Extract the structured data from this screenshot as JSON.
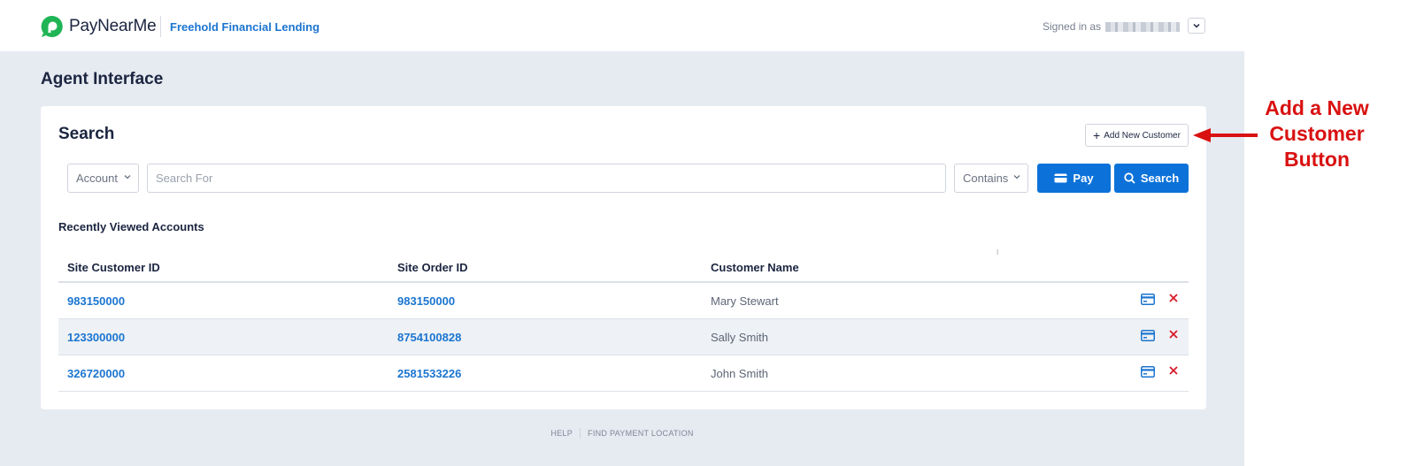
{
  "header": {
    "logo_text": "PayNearMe",
    "company": "Freehold Financial Lending",
    "signed_in_label": "Signed in as"
  },
  "page": {
    "title": "Agent Interface"
  },
  "search": {
    "title": "Search",
    "add_customer_label": "Add New Customer",
    "field_select": "Account",
    "input_placeholder": "Search For",
    "match_select": "Contains",
    "pay_label": "Pay",
    "search_label": "Search"
  },
  "recent": {
    "title": "Recently Viewed Accounts",
    "columns": [
      "Site Customer ID",
      "Site Order ID",
      "Customer Name"
    ],
    "rows": [
      {
        "customer_id": "983150000",
        "order_id": "983150000",
        "name": "Mary Stewart"
      },
      {
        "customer_id": "123300000",
        "order_id": "8754100828",
        "name": "Sally Smith"
      },
      {
        "customer_id": "326720000",
        "order_id": "2581533226",
        "name": "John Smith"
      }
    ]
  },
  "footer": {
    "links": [
      "HELP",
      "FIND PAYMENT LOCATION"
    ]
  },
  "annotation": {
    "lines": [
      "Add a New",
      "Customer",
      "Button"
    ]
  },
  "colors": {
    "brand_green": "#1fb455",
    "primary_blue": "#0c72d9",
    "link_blue": "#1b75d0",
    "delete_red": "#d91a2a",
    "annotation_red": "#d91111"
  },
  "icons": [
    "paynearme-logo-icon",
    "chevron-down-icon",
    "plus-icon",
    "card-icon",
    "search-icon",
    "close-icon",
    "arrow-left-icon"
  ]
}
